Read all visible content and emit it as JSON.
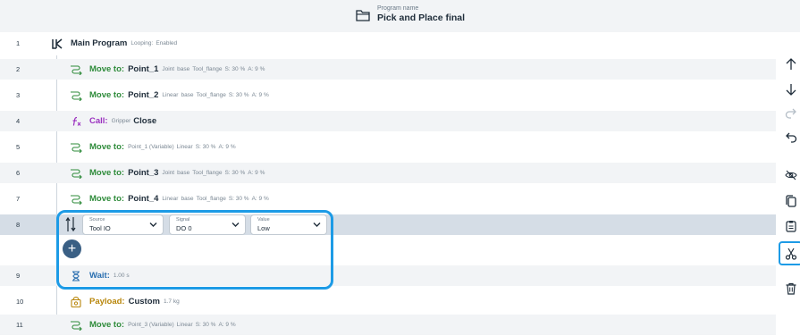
{
  "header": {
    "caption": "Program name",
    "title": "Pick and Place final"
  },
  "rows": [
    {
      "num": "1",
      "kw": "Main Program",
      "details": [
        "Looping:",
        "Enabled"
      ]
    },
    {
      "num": "2",
      "kw": "Move to:",
      "name": "Point_1",
      "details": [
        "Joint",
        "base",
        "Tool_flange",
        "S: 30 %",
        "A: 9 %"
      ]
    },
    {
      "num": "3",
      "kw": "Move to:",
      "name": "Point_2",
      "details": [
        "Linear",
        "base",
        "Tool_flange",
        "S: 30 %",
        "A: 9 %"
      ]
    },
    {
      "num": "4",
      "kw": "Call:",
      "details": [
        "Gripper"
      ],
      "name": "Close"
    },
    {
      "num": "5",
      "kw": "Move to:",
      "details": [
        "Point_1 (Variable)",
        "Linear",
        "S: 30 %",
        "A: 9 %"
      ]
    },
    {
      "num": "6",
      "kw": "Move to:",
      "name": "Point_3",
      "details": [
        "Joint",
        "base",
        "Tool_flange",
        "S: 30 %",
        "A: 9 %"
      ]
    },
    {
      "num": "7",
      "kw": "Move to:",
      "name": "Point_4",
      "details": [
        "Linear",
        "base",
        "Tool_flange",
        "S: 30 %",
        "A: 9 %"
      ]
    },
    {
      "num": "8"
    },
    {
      "num": "9",
      "kw": "Wait:",
      "details": [
        "1.00 s"
      ]
    },
    {
      "num": "10",
      "kw": "Payload:",
      "name": "Custom",
      "details": [
        "1.7 kg"
      ]
    },
    {
      "num": "11",
      "kw": "Move to:",
      "details": [
        "Point_3 (Variable)",
        "Linear",
        "S: 30 %",
        "A: 9 %"
      ]
    }
  ],
  "set_io": {
    "source": {
      "label": "Source",
      "value": "Tool IO"
    },
    "signal": {
      "label": "Signal",
      "value": "DO 0"
    },
    "value": {
      "label": "Value",
      "value": "Low"
    }
  },
  "add_label": "+",
  "icons": {
    "header": "folder-icon",
    "sidebar": [
      "arrow-up-icon",
      "arrow-down-icon",
      "redo-icon",
      "undo-icon",
      "hide-icon",
      "copy-icon",
      "paste-icon",
      "cut-icon",
      "delete-icon"
    ]
  },
  "colors": {
    "selection": "#1d9be6",
    "selected_row": "#d5dde6",
    "move": "#2e8b3a",
    "call": "#9a2fbf",
    "wait": "#2a6fb0",
    "payload": "#b8860b"
  }
}
